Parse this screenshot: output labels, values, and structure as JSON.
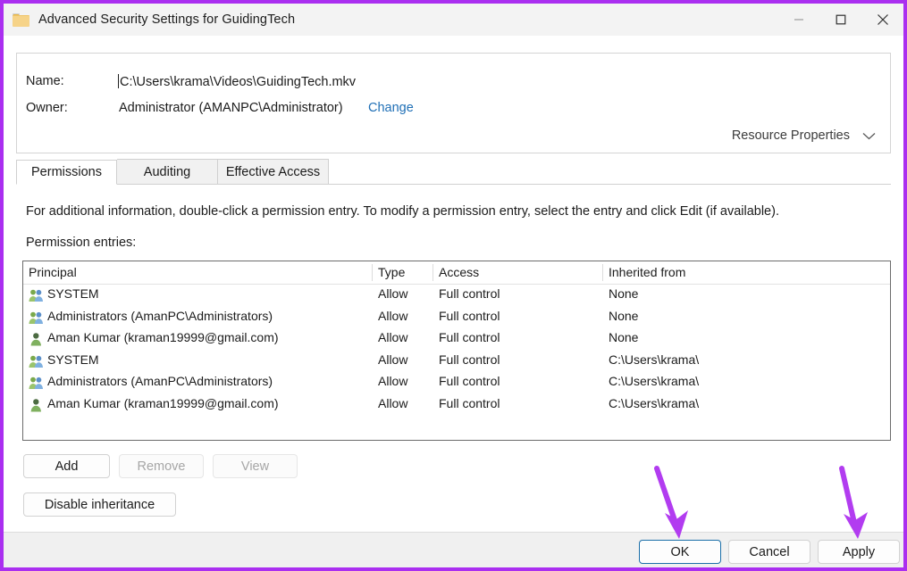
{
  "window": {
    "title": "Advanced Security Settings for GuidingTech",
    "folder_icon": "folder-icon",
    "controls": {
      "minimize": "minimize-icon",
      "maximize": "maximize-icon",
      "close": "close-icon"
    }
  },
  "header": {
    "name_label": "Name:",
    "name_value": "C:\\Users\\krama\\Videos\\GuidingTech.mkv",
    "owner_label": "Owner:",
    "owner_value": "Administrator (AMANPC\\Administrator)",
    "change_link": "Change",
    "resource_properties": "Resource Properties",
    "resource_properties_icon": "chevron-down-icon"
  },
  "tabs": [
    {
      "label": "Permissions",
      "active": true
    },
    {
      "label": "Auditing",
      "active": false
    },
    {
      "label": "Effective Access",
      "active": false
    }
  ],
  "body": {
    "info_text": "For additional information, double-click a permission entry. To modify a permission entry, select the entry and click Edit (if available).",
    "entries_label": "Permission entries:"
  },
  "table": {
    "columns": [
      "Principal",
      "Type",
      "Access",
      "Inherited from"
    ],
    "rows": [
      {
        "icon": "group-icon",
        "principal": "SYSTEM",
        "type": "Allow",
        "access": "Full control",
        "inherited": "None"
      },
      {
        "icon": "group-icon",
        "principal": "Administrators (AmanPC\\Administrators)",
        "type": "Allow",
        "access": "Full control",
        "inherited": "None"
      },
      {
        "icon": "user-icon",
        "principal": "Aman Kumar (kraman19999@gmail.com)",
        "type": "Allow",
        "access": "Full control",
        "inherited": "None"
      },
      {
        "icon": "group-icon",
        "principal": "SYSTEM",
        "type": "Allow",
        "access": "Full control",
        "inherited": "C:\\Users\\krama\\"
      },
      {
        "icon": "group-icon",
        "principal": "Administrators (AmanPC\\Administrators)",
        "type": "Allow",
        "access": "Full control",
        "inherited": "C:\\Users\\krama\\"
      },
      {
        "icon": "user-icon",
        "principal": "Aman Kumar (kraman19999@gmail.com)",
        "type": "Allow",
        "access": "Full control",
        "inherited": "C:\\Users\\krama\\"
      }
    ]
  },
  "buttons": {
    "add": "Add",
    "remove": "Remove",
    "view": "View",
    "disable_inheritance": "Disable inheritance",
    "ok": "OK",
    "cancel": "Cancel",
    "apply": "Apply"
  },
  "annotations": {
    "arrow_color": "#b23cf0",
    "arrows": [
      {
        "name": "arrow-pointing-to-ok",
        "target": "OK"
      },
      {
        "name": "arrow-pointing-to-apply",
        "target": "Apply"
      }
    ]
  },
  "colors": {
    "window_border": "#aa2ff0",
    "titlebar": "#f3f3f3",
    "footer": "#f0f0f0",
    "link": "#1f6fb6",
    "focus_ring": "#1a6ea8"
  }
}
